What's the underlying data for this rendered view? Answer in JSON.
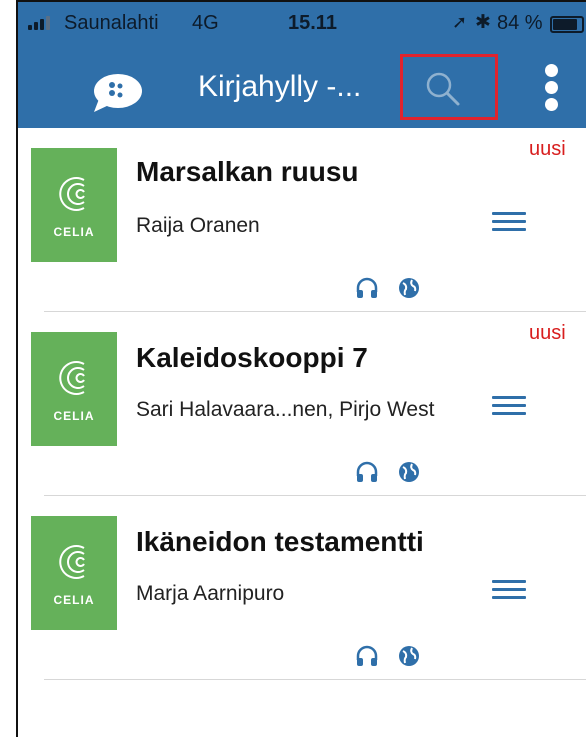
{
  "status_bar": {
    "carrier": "Saunalahti",
    "network": "4G",
    "time": "15.11",
    "battery_percent": "84 %",
    "battery_level": 0.84
  },
  "app_bar": {
    "title": "Kirjahylly -...",
    "chat_icon": "chat-bubble-icon",
    "search_icon": "search-icon",
    "menu_icon": "more-vertical-icon",
    "color": "#2f6fa9",
    "highlight_color": "#e0232e"
  },
  "books": [
    {
      "title": "Marsalkan ruusu",
      "author": "Raija Oranen",
      "cover_label": "CELIA",
      "badge": "uusi",
      "formats": [
        "headphones-icon",
        "globe-icon"
      ]
    },
    {
      "title": "Kaleidoskooppi 7",
      "author": "Sari Halavaara...nen, Pirjo West",
      "cover_label": "CELIA",
      "badge": "uusi",
      "formats": [
        "headphones-icon",
        "globe-icon"
      ]
    },
    {
      "title": "Ikäneidon testamentti",
      "author": "Marja Aarnipuro",
      "cover_label": "CELIA",
      "badge": "",
      "formats": [
        "headphones-icon",
        "globe-icon"
      ]
    }
  ],
  "colors": {
    "cover_green": "#65b15a",
    "badge_red": "#d81e1e"
  }
}
